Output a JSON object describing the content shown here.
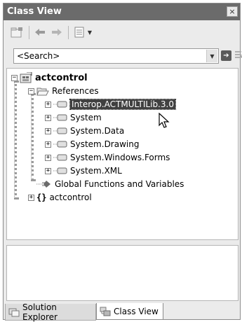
{
  "window": {
    "title": "Class View",
    "close_label": "×"
  },
  "toolbar": {
    "buttons": [
      {
        "name": "new-folder-icon"
      },
      {
        "name": "back-arrow-icon"
      },
      {
        "name": "forward-arrow-icon"
      },
      {
        "name": "settings-icon"
      },
      {
        "name": "chevron-down-icon"
      }
    ]
  },
  "search": {
    "value": "<Search>"
  },
  "tree": {
    "root": "actcontrol",
    "references": "References",
    "items": [
      "Interop.ACTMULTILib.3.0",
      "System",
      "System.Data",
      "System.Drawing",
      "System.Windows.Forms",
      "System.XML"
    ],
    "global": "Global Functions and Variables",
    "namespace_brace": "{}",
    "namespace": "actcontrol"
  },
  "tabs": {
    "solution_explorer": "Solution Explorer",
    "class_view": "Class View"
  },
  "colors": {
    "titlebar": "#6b6b6b",
    "selection": "#404040"
  }
}
